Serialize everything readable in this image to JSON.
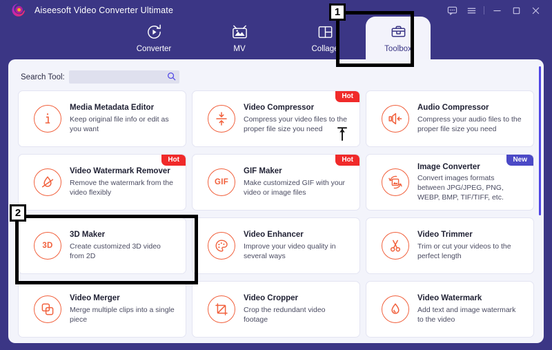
{
  "window": {
    "title": "Aiseesoft Video Converter Ultimate",
    "logo_icon": "aiseesoft-swirl-logo",
    "controls": [
      {
        "name": "feedback-icon",
        "glyph": "☰"
      },
      {
        "name": "menu-icon",
        "glyph": "☰"
      },
      {
        "name": "minimize-icon",
        "glyph": "—"
      },
      {
        "name": "maximize-icon",
        "glyph": "□"
      },
      {
        "name": "close-icon",
        "glyph": "✕"
      }
    ]
  },
  "tabs": [
    {
      "label": "Converter",
      "icon": "converter-icon",
      "active": false
    },
    {
      "label": "MV",
      "icon": "mv-icon",
      "active": false
    },
    {
      "label": "Collage",
      "icon": "collage-icon",
      "active": false
    },
    {
      "label": "Toolbox",
      "icon": "toolbox-icon",
      "active": true
    }
  ],
  "search": {
    "label": "Search Tool:",
    "value": "",
    "placeholder": "",
    "icon": "search-icon"
  },
  "tools": [
    {
      "title": "Media Metadata Editor",
      "desc": "Keep original file info or edit as you want",
      "icon": "info-icon",
      "badge": null
    },
    {
      "title": "Video Compressor",
      "desc": "Compress your video files to the proper file size you need",
      "icon": "compress-arrows-icon",
      "badge": "Hot"
    },
    {
      "title": "Audio Compressor",
      "desc": "Compress your audio files to the proper file size you need",
      "icon": "speaker-compress-icon",
      "badge": null
    },
    {
      "title": "Video Watermark Remover",
      "desc": "Remove the watermark from the video flexibly",
      "icon": "watermark-remove-icon",
      "badge": "Hot"
    },
    {
      "title": "GIF Maker",
      "desc": "Make customized GIF with your video or image files",
      "icon": "gif-icon",
      "badge": "Hot"
    },
    {
      "title": "Image Converter",
      "desc": "Convert images formats between JPG/JPEG, PNG, WEBP, BMP, TIF/TIFF, etc.",
      "icon": "image-convert-icon",
      "badge": "New"
    },
    {
      "title": "3D Maker",
      "desc": "Create customized 3D video from 2D",
      "icon": "3d-icon",
      "badge": null
    },
    {
      "title": "Video Enhancer",
      "desc": "Improve your video quality in several ways",
      "icon": "palette-icon",
      "badge": null
    },
    {
      "title": "Video Trimmer",
      "desc": "Trim or cut your videos to the perfect length",
      "icon": "scissors-icon",
      "badge": null
    },
    {
      "title": "Video Merger",
      "desc": "Merge multiple clips into a single piece",
      "icon": "merge-squares-icon",
      "badge": null
    },
    {
      "title": "Video Cropper",
      "desc": "Crop the redundant video footage",
      "icon": "crop-icon",
      "badge": null
    },
    {
      "title": "Video Watermark",
      "desc": "Add text and image watermark to the video",
      "icon": "droplet-icon",
      "badge": null
    }
  ],
  "annotations": [
    {
      "number": "1",
      "target": "toolbox-tab"
    },
    {
      "number": "2",
      "target": "3d-maker-card"
    }
  ],
  "colors": {
    "header_bg": "#3b3685",
    "panel_bg": "#f3f4fb",
    "accent_orange": "#f1603c",
    "badge_hot": "#f02a2a",
    "badge_new": "#4b49c6",
    "scrollbar": "#4f46e5"
  },
  "cursor": {
    "icon": "text-cursor-up-arrow"
  }
}
